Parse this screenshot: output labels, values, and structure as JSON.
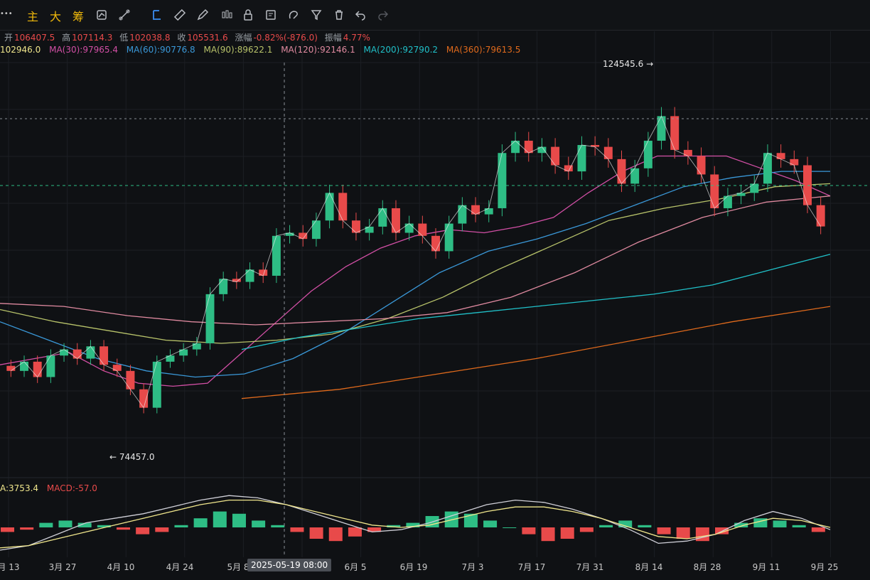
{
  "toolbar": {
    "menu_dots": "•••",
    "items": [
      "主",
      "大",
      "筹"
    ],
    "icons": [
      "indicator-icon",
      "draw-line-icon",
      "crosshair-select-icon",
      "ruler-icon",
      "pencil-icon",
      "candle-type-icon",
      "lock-icon",
      "note-icon",
      "magnet-icon",
      "filter-icon",
      "trash-icon",
      "undo-icon",
      "redo-icon"
    ]
  },
  "ohlc": {
    "open_label": "开",
    "open": "106407.5",
    "high_label": "高",
    "high": "107114.3",
    "low_label": "低",
    "low": "102038.8",
    "close_label": "收",
    "close": "105531.6",
    "change_label": "涨幅",
    "change": "-0.82%(-876.0)",
    "amp_label": "振幅",
    "amp": "4.77%"
  },
  "ma_legend": [
    {
      "text": "102946.0",
      "color": "#f0e68c"
    },
    {
      "text": "MA(30):97965.4",
      "color": "#d24fa5"
    },
    {
      "text": "MA(60):90776.8",
      "color": "#3a98d8"
    },
    {
      "text": "MA(90):89622.1",
      "color": "#b8c36a"
    },
    {
      "text": "MA(120):92146.1",
      "color": "#e08aa0"
    },
    {
      "text": "MA(200):92790.2",
      "color": "#20c0c8"
    },
    {
      "text": "MA(360):79613.5",
      "color": "#e06a1c"
    }
  ],
  "macd_legend": [
    {
      "text": "A:3753.4",
      "color": "#f0e68c"
    },
    {
      "text": "MACD:-57.0",
      "color": "#e84a4a"
    }
  ],
  "annotations": {
    "high_mark": "124545.6",
    "low_mark": "74457.0",
    "crosshair_date": "2025-05-19 08:00"
  },
  "chart_data": {
    "type": "candlestick",
    "x_ticks": [
      "月 13",
      "3月 27",
      "4月 10",
      "4月 24",
      "5月 8",
      "6月 5",
      "6月 19",
      "7月 3",
      "7月 17",
      "7月 31",
      "8月 14",
      "8月 28",
      "9月 11",
      "9月 25"
    ],
    "ylim": [
      66000,
      132000
    ],
    "grid": true,
    "highlights": {
      "max": 124545.6,
      "min": 74457.0
    },
    "price_closes": [
      82000,
      83500,
      81000,
      84500,
      85500,
      84000,
      86000,
      83000,
      82000,
      79000,
      76000,
      83500,
      84500,
      85500,
      86500,
      94500,
      97000,
      96500,
      98500,
      97500,
      104000,
      104500,
      103500,
      106500,
      111000,
      106500,
      104500,
      105500,
      108500,
      104500,
      106000,
      104000,
      101500,
      106000,
      109000,
      107500,
      108500,
      117500,
      119500,
      117500,
      118500,
      115500,
      114500,
      118800,
      118500,
      116500,
      112500,
      115000,
      119500,
      123500,
      118000,
      117000,
      114000,
      108500,
      110500,
      111000,
      112500,
      117500,
      116500,
      115500,
      109000,
      105531.6
    ],
    "ma_series": [
      {
        "name": "MA(30)",
        "color": "#d24fa5",
        "values": [
          83000,
          84000,
          85000,
          82000,
          80000,
          79500,
          80000,
          85000,
          90000,
          95000,
          99000,
          102000,
          104000,
          105000,
          104500,
          105500,
          107000,
          111000,
          114500,
          117000,
          117000,
          117000,
          115000,
          113000,
          110500
        ]
      },
      {
        "name": "MA(60)",
        "color": "#3a98d8",
        "values": [
          90000,
          87000,
          84000,
          82000,
          81000,
          81500,
          84000,
          88000,
          93000,
          98000,
          101500,
          103500,
          106000,
          109000,
          112000,
          113500,
          114500,
          114500
        ]
      },
      {
        "name": "MA(90)",
        "color": "#b8c36a",
        "values": [
          92000,
          90000,
          88500,
          87000,
          86500,
          87000,
          88000,
          90500,
          94000,
          98500,
          102500,
          106500,
          108500,
          110000,
          112000,
          112500
        ]
      },
      {
        "name": "MA(120)",
        "color": "#e08aa0",
        "values": [
          93000,
          92500,
          91000,
          90000,
          89500,
          90000,
          90500,
          91500,
          94000,
          98000,
          103000,
          107000,
          109500,
          110500
        ]
      },
      {
        "name": "MA(200)",
        "color": "#20c0c8",
        "values": [
          85500,
          87500,
          89000,
          90500,
          91500,
          92500,
          93500,
          94500,
          96000,
          98500,
          101000
        ]
      },
      {
        "name": "MA(360)",
        "color": "#e06a1c",
        "values": [
          77500,
          79000,
          81500,
          84000,
          87000,
          90000,
          92500
        ]
      }
    ],
    "macd": {
      "histogram": [
        -2,
        -1,
        2,
        3,
        2,
        1,
        -1,
        -3,
        -2,
        1,
        4,
        7,
        6,
        3,
        1,
        -2,
        -5,
        -6,
        -4,
        -2,
        1,
        2,
        5,
        7,
        6,
        3,
        0,
        -3,
        -6,
        -5,
        -2,
        1,
        3,
        1,
        -3,
        -5,
        -6,
        -3,
        2,
        4,
        3,
        1,
        -2
      ],
      "dif": [
        -10,
        -8,
        -3,
        2,
        4,
        6,
        9,
        12,
        14,
        13,
        10,
        6,
        2,
        -2,
        -1,
        2,
        6,
        10,
        12,
        11,
        8,
        4,
        -1,
        -7,
        -6,
        -3,
        3,
        7,
        4,
        -1
      ],
      "dea": [
        -9,
        -8,
        -5,
        -2,
        1,
        4,
        7,
        10,
        12,
        12,
        10,
        7,
        4,
        1,
        0,
        1,
        4,
        7,
        9,
        9,
        7,
        4,
        0,
        -4,
        -5,
        -3,
        1,
        4,
        3,
        0
      ]
    }
  }
}
